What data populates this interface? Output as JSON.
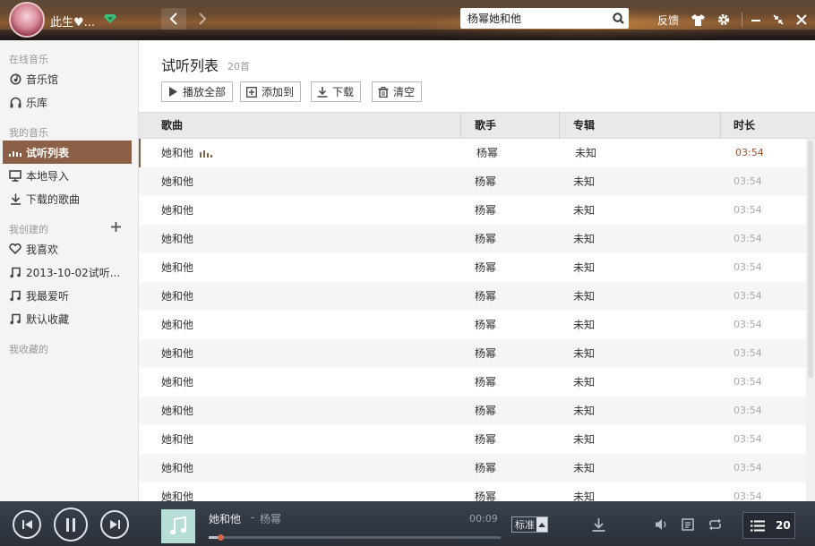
{
  "topbar": {
    "username": "此生♥...",
    "search_value": "杨幂她和他",
    "feedback_label": "反馈"
  },
  "sidebar": {
    "online_title": "在线音乐",
    "online_items": [
      {
        "label": "音乐馆",
        "icon": "music-hall-icon"
      },
      {
        "label": "乐库",
        "icon": "headphones-icon"
      }
    ],
    "my_title": "我的音乐",
    "my_items": [
      {
        "label": "试听列表",
        "icon": "playing-bars-icon",
        "active": true
      },
      {
        "label": "本地导入",
        "icon": "monitor-icon"
      },
      {
        "label": "下载的歌曲",
        "icon": "download-icon"
      }
    ],
    "created_title": "我创建的",
    "created_items": [
      {
        "label": "我喜欢",
        "icon": "heart-icon"
      },
      {
        "label": "2013-10-02试听...",
        "icon": "music-note-icon"
      },
      {
        "label": "我最爱听",
        "icon": "music-note-icon"
      },
      {
        "label": "默认收藏",
        "icon": "music-note-icon"
      }
    ],
    "collected_title": "我收藏的"
  },
  "main": {
    "title": "试听列表",
    "count": "20首",
    "toolbar": {
      "play_all": "播放全部",
      "add_to": "添加到",
      "download": "下载",
      "clear": "清空"
    },
    "columns": {
      "song": "歌曲",
      "artist": "歌手",
      "album": "专辑",
      "duration": "时长"
    },
    "rows": [
      {
        "title": "她和他",
        "artist": "杨幂",
        "album": "未知",
        "duration": "03:54"
      },
      {
        "title": "她和他",
        "artist": "杨幂",
        "album": "未知",
        "duration": "03:54"
      },
      {
        "title": "她和他",
        "artist": "杨幂",
        "album": "未知",
        "duration": "03:54"
      },
      {
        "title": "她和他",
        "artist": "杨幂",
        "album": "未知",
        "duration": "03:54"
      },
      {
        "title": "她和他",
        "artist": "杨幂",
        "album": "未知",
        "duration": "03:54"
      },
      {
        "title": "她和他",
        "artist": "杨幂",
        "album": "未知",
        "duration": "03:54"
      },
      {
        "title": "她和他",
        "artist": "杨幂",
        "album": "未知",
        "duration": "03:54"
      },
      {
        "title": "她和他",
        "artist": "杨幂",
        "album": "未知",
        "duration": "03:54"
      },
      {
        "title": "她和他",
        "artist": "杨幂",
        "album": "未知",
        "duration": "03:54"
      },
      {
        "title": "她和他",
        "artist": "杨幂",
        "album": "未知",
        "duration": "03:54"
      },
      {
        "title": "她和他",
        "artist": "杨幂",
        "album": "未知",
        "duration": "03:54"
      },
      {
        "title": "她和他",
        "artist": "杨幂",
        "album": "未知",
        "duration": "03:54"
      },
      {
        "title": "她和他",
        "artist": "杨幂",
        "album": "未知",
        "duration": "03:54"
      }
    ]
  },
  "player": {
    "title": "她和他",
    "separator": "-",
    "artist": "杨幂",
    "elapsed": "00:09",
    "progress_fraction": 0.04,
    "quality": "标准",
    "playlist_count": "20"
  },
  "colors": {
    "accent": "#8b6046",
    "player_bg": "#2f353f",
    "playing_duration": "#a0522d"
  }
}
